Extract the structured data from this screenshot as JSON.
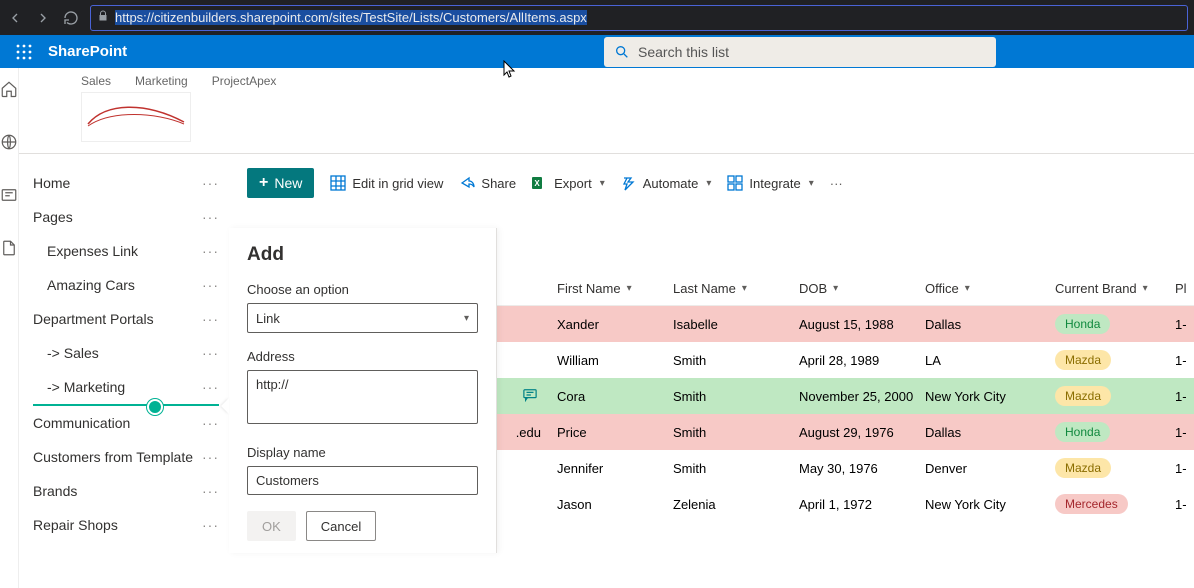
{
  "browser": {
    "url": "https://citizenbuilders.sharepoint.com/sites/TestSite/Lists/Customers/AllItems.aspx"
  },
  "suite": {
    "brand": "SharePoint",
    "search_placeholder": "Search this list"
  },
  "hub_links": [
    "Sales",
    "Marketing",
    "ProjectApex"
  ],
  "sidenav": [
    {
      "label": "Home",
      "sub": false
    },
    {
      "label": "Pages",
      "sub": false
    },
    {
      "label": "Expenses Link",
      "sub": true
    },
    {
      "label": "Amazing Cars",
      "sub": true
    },
    {
      "label": "Department Portals",
      "sub": false
    },
    {
      "label": "-> Sales",
      "sub": true
    },
    {
      "label": "-> Marketing",
      "sub": true,
      "selected": true
    },
    {
      "label": "Communication",
      "sub": false
    },
    {
      "label": "Customers from Template",
      "sub": false
    },
    {
      "label": "Brands",
      "sub": false
    },
    {
      "label": "Repair Shops",
      "sub": false
    }
  ],
  "commands": {
    "new": "New",
    "edit": "Edit in grid view",
    "share": "Share",
    "export": "Export",
    "automate": "Automate",
    "integrate": "Integrate"
  },
  "list_title": "Customers",
  "columns": [
    "First Name",
    "Last Name",
    "DOB",
    "Office",
    "Current Brand",
    "Pl"
  ],
  "rows": [
    {
      "state": "red",
      "fn": "Xander",
      "ln": "Isabelle",
      "dob": "August 15, 1988",
      "office": "Dallas",
      "brand": "Honda",
      "brandStyle": "honda",
      "trail": "1-"
    },
    {
      "state": "",
      "fn": "William",
      "ln": "Smith",
      "dob": "April 28, 1989",
      "office": "LA",
      "brand": "Mazda",
      "brandStyle": "mazda",
      "trail": "1-"
    },
    {
      "state": "green",
      "fn": "Cora",
      "ln": "Smith",
      "dob": "November 25, 2000",
      "office": "New York City",
      "brand": "Mazda",
      "brandStyle": "mazda",
      "trail": "1-",
      "comment": true,
      "pre": ""
    },
    {
      "state": "red",
      "fn": "Price",
      "ln": "Smith",
      "dob": "August 29, 1976",
      "office": "Dallas",
      "brand": "Honda",
      "brandStyle": "honda",
      "trail": "1-",
      "pre": ".edu"
    },
    {
      "state": "",
      "fn": "Jennifer",
      "ln": "Smith",
      "dob": "May 30, 1976",
      "office": "Denver",
      "brand": "Mazda",
      "brandStyle": "mazda",
      "trail": "1-"
    },
    {
      "state": "",
      "fn": "Jason",
      "ln": "Zelenia",
      "dob": "April 1, 1972",
      "office": "New York City",
      "brand": "Mercedes",
      "brandStyle": "merc",
      "trail": "1-"
    }
  ],
  "panel": {
    "title": "Add",
    "option_label": "Choose an option",
    "option_value": "Link",
    "address_label": "Address",
    "address_value": "http://",
    "display_label": "Display name",
    "display_value": "Customers",
    "ok": "OK",
    "cancel": "Cancel"
  }
}
